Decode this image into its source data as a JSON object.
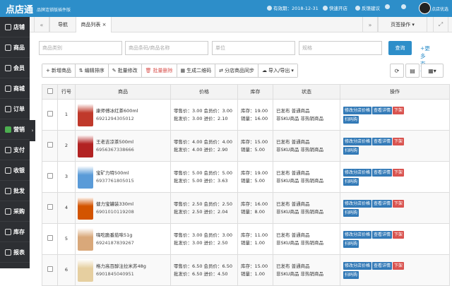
{
  "topbar": {
    "logo": "点店通",
    "sublogo": "品牌连锁版插件版",
    "expiry": "有效期：2018-12-31",
    "quick_open": "快速开店",
    "feedback": "反馈建议",
    "shop_name": "点店优选"
  },
  "sidebar": {
    "items": [
      {
        "label": "店铺",
        "icon": "store-icon"
      },
      {
        "label": "商品",
        "icon": "goods-icon"
      },
      {
        "label": "会员",
        "icon": "member-icon"
      },
      {
        "label": "商城",
        "icon": "mall-icon"
      },
      {
        "label": "订单",
        "icon": "order-icon"
      },
      {
        "label": "营销",
        "icon": "marketing-icon"
      },
      {
        "label": "支付",
        "icon": "pay-icon"
      },
      {
        "label": "收银",
        "icon": "cashier-icon"
      },
      {
        "label": "批发",
        "icon": "wholesale-icon"
      },
      {
        "label": "采购",
        "icon": "purchase-icon"
      },
      {
        "label": "库存",
        "icon": "inventory-icon"
      },
      {
        "label": "报表",
        "icon": "report-icon"
      }
    ]
  },
  "tabs": {
    "nav": "导航",
    "list": "商品列表",
    "close": "×",
    "page_ops": "页签操作"
  },
  "filters": {
    "category": "商品类别",
    "barcode": "商品条码/商品名称",
    "unit": "单位",
    "spec": "规格",
    "search": "查询",
    "more": "+更多查询"
  },
  "toolbar": {
    "add": "新增商品",
    "sort": "编辑排序",
    "batch_edit": "批量修改",
    "batch_delete": "批量删除",
    "qrcode": "生成二维码",
    "sync": "分店商品同步",
    "import_export": "导入/导出"
  },
  "table": {
    "headers": [
      "行号",
      "商品",
      "价格",
      "库存",
      "状态",
      "操作"
    ],
    "ops": {
      "edit": "修改分店价格",
      "detail": "查看详情",
      "off": "下架",
      "scan": "扫码购"
    },
    "rows": [
      {
        "no": "1",
        "name": "康师傅冰红茶600ml",
        "code": "6921294305012",
        "price1": "零售价：3.00 会员价：3.00",
        "price2": "批发价：3.00 进价：2.10",
        "stock": "库存：19.00",
        "sales": "销量：16.00",
        "status1": "已发布 普通商品",
        "status2": "非SKU商品 非热销商品",
        "color": "#c0392b"
      },
      {
        "no": "2",
        "name": "王老吉凉茶500ml",
        "code": "6956367338666",
        "price1": "零售价：4.00 会员价：4.00",
        "price2": "批发价：4.00 进价：2.90",
        "stock": "库存：15.00",
        "sales": "销量：5.00",
        "status1": "已发布 普通商品",
        "status2": "非SKU商品 非热销商品",
        "color": "#b22222"
      },
      {
        "no": "3",
        "name": "宝矿力特500ml",
        "code": "6937761805015",
        "price1": "零售价：5.00 会员价：5.00",
        "price2": "批发价：5.00 进价：3.63",
        "stock": "库存：19.00",
        "sales": "销量：5.00",
        "status1": "已发布 普通商品",
        "status2": "非SKU商品 非热销商品",
        "color": "#5a9bd8"
      },
      {
        "no": "4",
        "name": "健力宝罐装330ml",
        "code": "6901010119208",
        "price1": "零售价：2.50 会员价：2.50",
        "price2": "批发价：2.50 进价：2.04",
        "stock": "库存：16.00",
        "sales": "销量：8.00",
        "status1": "已发布 普通商品",
        "status2": "非SKU商品 非热销商品",
        "color": "#d35400"
      },
      {
        "no": "5",
        "name": "嗨吃脆番茄味51g",
        "code": "6924187839267",
        "price1": "零售价：3.00 会员价：3.00",
        "price2": "批发价：3.00 进价：2.50",
        "stock": "库存：11.00",
        "sales": "销量：1.00",
        "status1": "已发布 普通商品",
        "status2": "非SKU商品 非热销商品",
        "color": "#d9a87a"
      },
      {
        "no": "6",
        "name": "格力高百醇注拉米苏48g",
        "code": "6901845040951",
        "price1": "零售价：6.50 会员价：6.50",
        "price2": "批发价：6.50 进价：4.50",
        "stock": "库存：15.00",
        "sales": "销量：1.00",
        "status1": "已发布 普通商品",
        "status2": "非SKU商品 非热销商品",
        "color": "#e6cfa0"
      }
    ]
  }
}
